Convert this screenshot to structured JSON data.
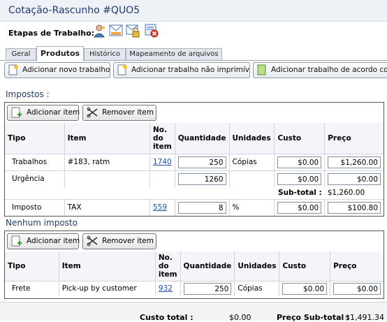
{
  "window": {
    "title": "Cotação-Rascunho #QUO5"
  },
  "stages": {
    "label": "Etapas de Trabalho:",
    "icons": [
      "user-icon",
      "mail-icon",
      "lock-mail-icon",
      "delete-icon"
    ]
  },
  "tabs": [
    {
      "label": "Geral",
      "active": false
    },
    {
      "label": "Produtos",
      "active": true
    },
    {
      "label": "Histórico",
      "active": false
    },
    {
      "label": "Mapeamento de arquivos",
      "active": false
    }
  ],
  "toolbar": {
    "add_job": "Adicionar novo trabalho",
    "add_nonprint": "Adicionar trabalho não imprimível",
    "add_according": "Adicionar trabalho de acordo com"
  },
  "taxes": {
    "title": "Impostos :",
    "add_button": "Adicionar item",
    "remove_button": "Remover item",
    "columns": [
      "Tipo",
      "Item",
      "No. do item",
      "Quantidade",
      "Unidades",
      "Custo",
      "Preço"
    ],
    "rows": [
      {
        "type": "Trabalhos",
        "item": "#183, ratm",
        "item_no": "1740",
        "qty": "250",
        "units": "Cópias",
        "cost": "$0.00",
        "price": "$1,260.00"
      },
      {
        "type": "Urgência",
        "item": "",
        "item_no": "",
        "qty": "1260",
        "units": "",
        "cost": "$0.00",
        "price": "$0.00"
      }
    ],
    "subtotal_label": "Sub-total :",
    "subtotal_value": "$1,260.00",
    "tax_row": {
      "type": "Imposto",
      "item": "TAX",
      "item_no": "559",
      "qty": "8",
      "units": "%",
      "cost": "$0.00",
      "price": "$100.80"
    }
  },
  "notax": {
    "title": "Nenhum imposto",
    "add_button": "Adicionar item",
    "remove_button": "Remover item",
    "columns": [
      "Tipo",
      "Item",
      "No. do item",
      "Quantidade",
      "Unidades",
      "Custo",
      "Preço"
    ],
    "rows": [
      {
        "type": "Frete",
        "item": "Pick-up by customer",
        "item_no": "932",
        "qty": "250",
        "units": "Cópias",
        "cost": "$0.00",
        "price": "$0.00"
      }
    ]
  },
  "footer": {
    "total_cost_label": "Custo total :",
    "total_cost_value": "$0.00",
    "subtotal_price_label": "Preço Sub-total :",
    "subtotal_price_value": "$1,491.34"
  }
}
